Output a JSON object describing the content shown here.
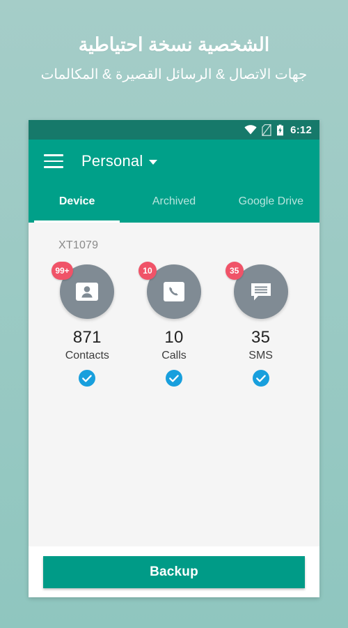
{
  "promo": {
    "title": "الشخصية نسخة احتياطية",
    "subtitle": "جهات الاتصال & الرسائل القصيرة & المكالمات"
  },
  "statusbar": {
    "time": "6:12",
    "icons": [
      "wifi-icon",
      "no-sim-icon",
      "battery-charging-icon"
    ]
  },
  "appbar": {
    "menu_icon": "hamburger-menu-icon",
    "account_label": "Personal",
    "dropdown_icon": "caret-down-icon"
  },
  "tabs": [
    {
      "label": "Device",
      "active": true
    },
    {
      "label": "Archived",
      "active": false
    },
    {
      "label": "Google Drive",
      "active": false
    }
  ],
  "content": {
    "device_name": "XT1079",
    "items": [
      {
        "badge": "99+",
        "count": "871",
        "label": "Contacts",
        "icon": "contact-card-icon",
        "selected": true
      },
      {
        "badge": "10",
        "count": "10",
        "label": "Calls",
        "icon": "phone-icon",
        "selected": true
      },
      {
        "badge": "35",
        "count": "35",
        "label": "SMS",
        "icon": "message-icon",
        "selected": true
      }
    ]
  },
  "footer": {
    "backup_label": "Backup"
  },
  "colors": {
    "page_background_top": "#a5cdc8",
    "page_background_bottom": "#8fc6bf",
    "status_bar": "#16796a",
    "app_bar": "#00a089",
    "content_background": "#f5f5f5",
    "circle": "#808b94",
    "badge": "#f05368",
    "check": "#189fdd",
    "backup_button": "#009b87"
  }
}
